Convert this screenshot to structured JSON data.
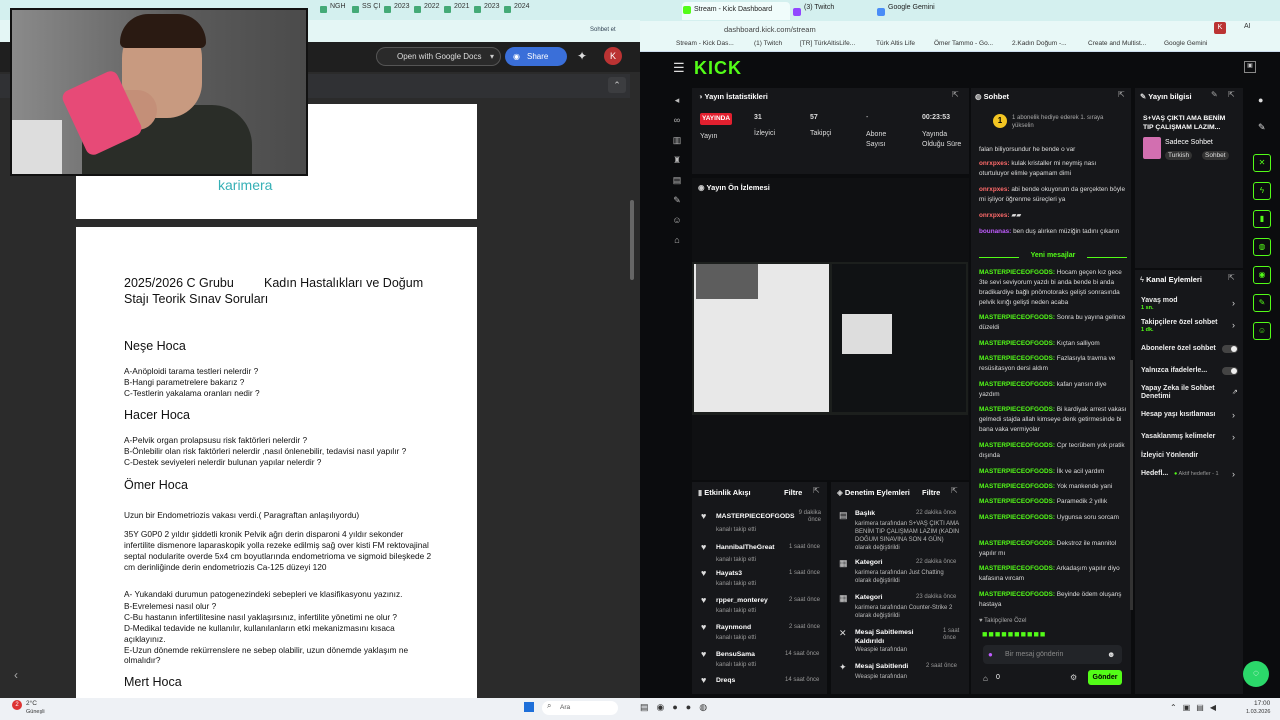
{
  "left_browser": {
    "tabs": [
      "NGH",
      "SS Çİ",
      "2023",
      "2022",
      "2021",
      "2023",
      "2024"
    ],
    "profile_pill": "Sohbet et",
    "doc_toolbar": {
      "open_with": "Open with Google Docs",
      "share": "Share",
      "avatar": "K"
    },
    "doc_header_logo": "karimera",
    "doc": {
      "title_left": "2025/2026 C Grubu",
      "title_right": "Kadın Hastalıkları ve Doğum",
      "title_line2": "Stajı Teorik Sınav Soruları",
      "sections": [
        {
          "heading": "Neşe Hoca",
          "lines": [
            "A-Anöploidi tarama testleri nelerdir ?",
            "B-Hangi parametrelere bakarız ?",
            "C-Testlerin yakalama oranları nedir ?"
          ]
        },
        {
          "heading": "Hacer Hoca",
          "lines": [
            "A-Pelvik organ prolapsusu risk faktörleri nelerdir ?",
            "B-Önlebilir olan risk faktörleri nelerdir ,nasıl önlenebilir, tedavisi nasıl yapılır ?",
            "C-Destek seviyeleri nelerdir bulunan yapılar nelerdir ?"
          ]
        },
        {
          "heading": "Ömer Hoca",
          "lines": [
            "Uzun bir Endometriozis vakası verdi.( Paragraftan anlaşılıyordu)",
            "35Y G0P0 2 yıldır şiddetli kronik Pelvik ağrı derin disparoni 4 yıldır sekonder",
            "infertilite dismenore laparaskopik yolla rezeke edilmiş sağ over kisti FM rektovajinal",
            "septal nodularite overde 5x4 cm boyutlarında endometrioma ve sigmoid bileşkede 2",
            "cm derinliğinde derin endometriozis Ca-125 düzeyi 120",
            "A- Yukandaki durumun patogenezindeki sebepleri ve klasifikasyonu yazınız.",
            "B-Evrelemesi nasıl olur ?",
            "C-Bu hastanın infertilitesine nasıl yaklaşırsınız, infertilite yönetimi ne olur ?",
            "D-Medikal tedavide ne kullanılır, kullanılanların etki mekanizmasını kısaca",
            "açıklayınız.",
            "E-Uzun dönemde rekürrenslere ne  sebep olabilir, uzun dönemde yaklaşım ne",
            "olmalıdır?"
          ]
        },
        {
          "heading": "Mert Hoca",
          "lines": []
        }
      ]
    }
  },
  "right_browser": {
    "tabs": [
      "Stream - Kick Dashboard",
      "(3) Twitch",
      "Google Gemini"
    ],
    "url": "dashboard.kick.com/stream",
    "bookmarks": [
      "Stream - Kick Das...",
      "(1) Twitch",
      "[TR] TürkAltisLife...",
      "Türk Altis Life",
      "Ömer Tammo - Go...",
      "2.Kadın Doğum -...",
      "Create and Multist...",
      "Google Gemini"
    ],
    "avatar": "K",
    "ai_label": "AI"
  },
  "kick": {
    "logo": "KICK",
    "stats_panel": {
      "title": "Yayın İstatistikleri",
      "live_badge": "YAYINDA",
      "live_label": "Yayın",
      "viewers": "31",
      "viewers_label": "İzleyici",
      "followers": "57",
      "followers_label": "Takipçi",
      "subs": "-",
      "subs_label": "Abone Sayısı",
      "uptime": "00:23:53",
      "uptime_label": "Yayında Olduğu Süre"
    },
    "preview_title": "Yayın Ön İzlemesi",
    "chat": {
      "title": "Sohbet",
      "pinned": "1 abonelik hediye ederek 1. sıraya yükselin",
      "pinned_rank": "1",
      "messages": [
        {
          "user": "",
          "text": "falan biliyorsundur he bende o var"
        },
        {
          "user": "onrxpxes:",
          "text": "kulak kristaller mi neymiş nası oturtuluyor elimle yapamam dimi"
        },
        {
          "user": "onrxpxes:",
          "text": "abi bende okuyorum da gerçekten böyle mi işliyor öğrenme süreçleri ya"
        },
        {
          "user": "onrxpxes:",
          "text": ""
        },
        {
          "user": "bounanas:",
          "text": "ben duş alırken müziğin tadını çıkarın"
        }
      ],
      "new_messages": "Yeni mesajlar",
      "new": [
        {
          "user": "MASTERPIECEOFGODS:",
          "text": "Hocam geçen kız gece 3te sevi seviyorum yazdı bi anda bende bi anda bradikardiye bağlı pnömotoraks gelişti sonrasında pelvik kırığı gelişti neden acaba"
        },
        {
          "user": "MASTERPIECEOFGODS:",
          "text": "Sonra bu yayına gelince düzeldi"
        },
        {
          "user": "MASTERPIECEOFGODS:",
          "text": "Kıçtan salliyom"
        },
        {
          "user": "MASTERPIECEOFGODS:",
          "text": "Fazlasıyla travma ve resüsitasyon dersi aldım"
        },
        {
          "user": "MASTERPIECEOFGODS:",
          "text": "kafan yansın diye yazdım"
        },
        {
          "user": "MASTERPIECEOFGODS:",
          "text": "Bi kardiyak arrest vakası gelmedi stajda allah kimseye denk getirmesinde bi bana vaka vermiyolar"
        },
        {
          "user": "MASTERPIECEOFGODS:",
          "text": "Cpr tecrübem yok pratik dışında"
        },
        {
          "user": "MASTERPIECEOFGODS:",
          "text": "İlk ve acil yardım"
        },
        {
          "user": "MASTERPIECEOFGODS:",
          "text": "Yok mankende yani"
        },
        {
          "user": "MASTERPIECEOFGODS:",
          "text": "Paramedik 2 yıllık"
        },
        {
          "user": "MASTERPIECEOFGODS:",
          "text": "Uygunsa soru sorcam"
        },
        {
          "user": "MASTERPIECEOFGODS:",
          "text": "Dekstroz ile mannitol yapılır mı"
        },
        {
          "user": "MASTERPIECEOFGODS:",
          "text": "Arkadaşım yapılır diyo kafasına vırcam"
        },
        {
          "user": "MASTERPIECEOFGODS:",
          "text": "Beyinde ödem oluşanş hastaya"
        }
      ],
      "emote_label": "Takipçilere Özel",
      "input_placeholder": "Bir mesaj gönderin",
      "count": "0",
      "send": "Gönder"
    },
    "activity": {
      "title": "Etkinlik Akışı",
      "filter": "Filtre",
      "items": [
        {
          "name": "MASTERPIECEOFGODS",
          "sub": "kanalı takip etti",
          "time": "9 dakika önce"
        },
        {
          "name": "HannibalTheGreat",
          "sub": "kanalı takip etti",
          "time": "1 saat önce"
        },
        {
          "name": "Hayats3",
          "sub": "kanalı takip etti",
          "time": "1 saat önce"
        },
        {
          "name": "rpper_monterey",
          "sub": "kanalı takip etti",
          "time": "2 saat önce"
        },
        {
          "name": "Raynmond",
          "sub": "kanalı takip etti",
          "time": "2 saat önce"
        },
        {
          "name": "BensuSama",
          "sub": "kanalı takip etti",
          "time": "14 saat önce"
        },
        {
          "name": "Dreqs",
          "sub": "",
          "time": "14 saat önce"
        }
      ]
    },
    "mod_actions": {
      "title": "Denetim Eylemleri",
      "filter": "Filtre",
      "items": [
        {
          "title": "Başlık",
          "time": "22 dakika önce",
          "line1": "karimera tarafından S+VAŞ ÇIKTI AMA BENİM TIP ÇALIŞMAM LAZIM (KADIN DOĞUM SINAVINA SON 4 GÜN) olarak değiştirildi"
        },
        {
          "title": "Kategori",
          "time": "22 dakika önce",
          "line1": "karimera tarafından Just Chatting olarak değiştirildi"
        },
        {
          "title": "Kategori",
          "time": "23 dakika önce",
          "line1": "karimera tarafından Counter-Strike 2 olarak değiştirildi"
        },
        {
          "title": "Mesaj Sabitlemesi Kaldırıldı",
          "time": "1 saat önce",
          "line1": "Weaspie tarafından"
        },
        {
          "title": "Mesaj Sabitlendi",
          "time": "2 saat önce",
          "line1": "Weaspie tarafından"
        }
      ]
    },
    "stream_info": {
      "title": "Yayın bilgisi",
      "stream_title": "S+VAŞ ÇIKTI AMA BENİM TIP ÇALIŞMAM LAZIM...",
      "category": "Sadece Sohbet",
      "tags": [
        "Turkish",
        "Sohbet"
      ]
    },
    "channel_actions": {
      "title": "Kanal Eylemleri",
      "items": [
        {
          "label": "Yavaş mod",
          "sub": "1 sn."
        },
        {
          "label": "Takipçilere özel sohbet",
          "sub": "1 dk."
        },
        {
          "label": "Abonelere özel sohbet",
          "sub": ""
        },
        {
          "label": "Yalnızca ifadelerle...",
          "sub": ""
        },
        {
          "label": "Yapay Zeka ile Sohbet Denetimi",
          "sub": ""
        },
        {
          "label": "Hesap yaşı kısıtlaması",
          "sub": ""
        },
        {
          "label": "Yasaklanmış kelimeler",
          "sub": ""
        },
        {
          "label": "İzleyici Yönlendir",
          "sub": ""
        },
        {
          "label": "Hedefl...",
          "sub": "Aktif hedefler - 1"
        }
      ]
    }
  },
  "taskbar": {
    "weather": "2°C",
    "weather_desc": "Güneşli",
    "search": "Ara",
    "time": "17:00",
    "date": "1.03.2026",
    "badge": "2"
  },
  "colors": {
    "kick_green": "#53fc18",
    "live_red": "#e2202f",
    "left_accent": "#36b0b6"
  }
}
